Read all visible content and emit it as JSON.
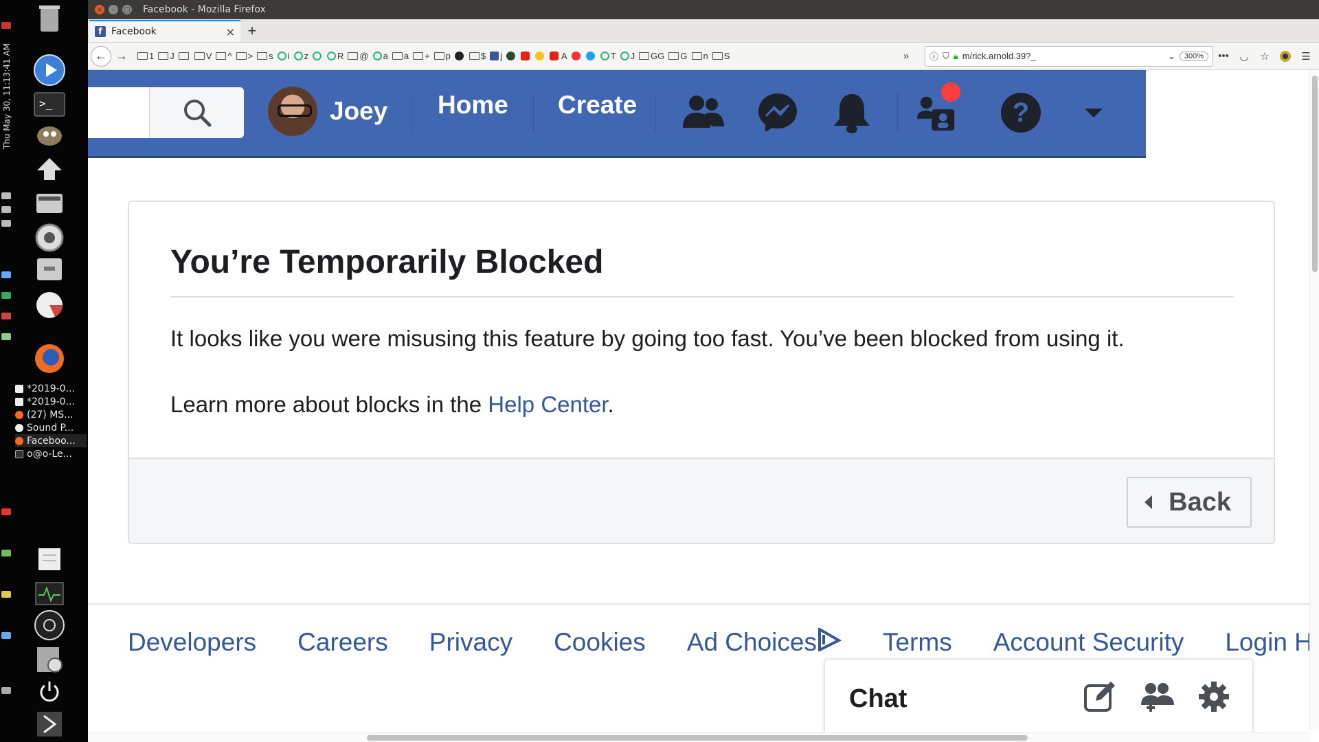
{
  "desktop": {
    "clock": "Thu May 30, 11:13:41 AM",
    "taskbar_items": [
      {
        "label": "*2019-0..."
      },
      {
        "label": "*2019-0..."
      },
      {
        "label": "(27) MS..."
      },
      {
        "label": "Sound P..."
      },
      {
        "label": "Faceboo..."
      },
      {
        "label": "o@o-Le..."
      }
    ]
  },
  "browser": {
    "window_title": "Facebook - Mozilla Firefox",
    "tab_title": "Facebook",
    "url": "m/rick.arnold.39?_",
    "zoom": "300%",
    "bookmarks": [
      "1",
      "J",
      "",
      "V",
      "^",
      ">",
      "s",
      "i",
      "z",
      "",
      "R",
      "@",
      "a",
      "a",
      "+",
      "p",
      "",
      "$",
      "j",
      "",
      "",
      "",
      "",
      "A",
      "",
      "",
      "T",
      "J",
      "GG",
      "G",
      "n",
      "S"
    ]
  },
  "header": {
    "user_name": "Joey",
    "home_label": "Home",
    "create_label": "Create"
  },
  "block": {
    "title": "You’re Temporarily Blocked",
    "message": "It looks like you were misusing this feature by going too fast. You’ve been blocked from using it.",
    "learn_prefix": "Learn more about blocks in the ",
    "help_link": "Help Center",
    "learn_suffix": ".",
    "back_label": "Back"
  },
  "footer": {
    "links": [
      "Developers",
      "Careers",
      "Privacy",
      "Cookies",
      "Ad Choices",
      "Terms",
      "Account Security",
      "Login Hel"
    ]
  },
  "chat": {
    "title": "Chat"
  },
  "colors": {
    "facebook_blue": "#4267b2",
    "link_blue": "#365899",
    "notification_red": "#fa3e3e"
  }
}
